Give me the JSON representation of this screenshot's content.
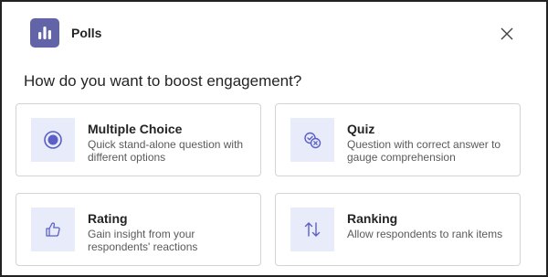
{
  "app": {
    "title": "Polls",
    "icon": "bar-chart-icon",
    "accent_color": "#6264a7"
  },
  "close": {
    "icon": "close-icon"
  },
  "prompt": "How do you want to boost engagement?",
  "options": [
    {
      "title": "Multiple Choice",
      "description": "Quick stand-alone question with different options",
      "icon": "radio-button-icon"
    },
    {
      "title": "Quiz",
      "description": "Question with correct answer to gauge comprehension",
      "icon": "quiz-check-icon"
    },
    {
      "title": "Rating",
      "description": "Gain insight from your respondents' reactions",
      "icon": "thumbs-up-icon"
    },
    {
      "title": "Ranking",
      "description": "Allow respondents to rank items",
      "icon": "arrow-up-down-icon"
    }
  ],
  "colors": {
    "icon_tile_bg": "#e8ebfa",
    "icon_stroke": "#5b5fc7"
  }
}
